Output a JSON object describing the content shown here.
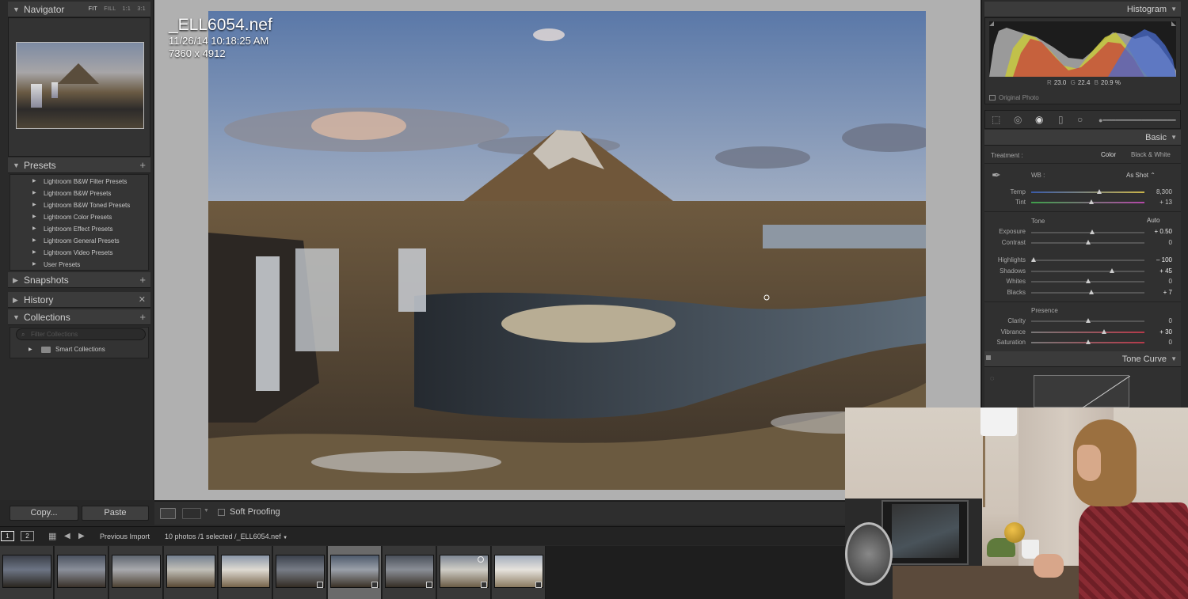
{
  "left_panel": {
    "navigator": {
      "title": "Navigator",
      "zoom": [
        "FIT",
        "FILL",
        "1:1",
        "3:1"
      ]
    },
    "presets": {
      "title": "Presets",
      "items": [
        "Lightroom B&W Filter Presets",
        "Lightroom B&W Presets",
        "Lightroom B&W Toned Presets",
        "Lightroom Color Presets",
        "Lightroom Effect Presets",
        "Lightroom General Presets",
        "Lightroom Video Presets",
        "User Presets"
      ]
    },
    "snapshots": {
      "title": "Snapshots"
    },
    "history": {
      "title": "History"
    },
    "collections": {
      "title": "Collections",
      "search_placeholder": "Filter Collections",
      "items": [
        "Smart Collections"
      ]
    },
    "copy_label": "Copy...",
    "paste_label": "Paste"
  },
  "photo_info": {
    "filename": "_ELL6054.nef",
    "datetime": "11/26/14 10:18:25 AM",
    "dimensions": "7360 x 4912"
  },
  "toolbar": {
    "soft_proofing": "Soft Proofing"
  },
  "filmstrip": {
    "screen1": "1",
    "screen2": "2",
    "source": "Previous Import",
    "status": "10 photos /1 selected /_ELL6054.nef",
    "thumb_count": 10,
    "selected_index": 6
  },
  "right_panel": {
    "histogram": {
      "title": "Histogram",
      "r_key": "R",
      "r": "23.0",
      "g_key": "G",
      "g": "22.4",
      "b_key": "B",
      "b": "20.9",
      "pct": "%",
      "original_photo": "Original Photo"
    },
    "basic": {
      "title": "Basic",
      "treatment_label": "Treatment :",
      "color_label": "Color",
      "bw_label": "Black & White",
      "wb_label": "WB :",
      "wb_value": "As Shot",
      "tone_label": "Tone",
      "auto_label": "Auto",
      "presence_label": "Presence",
      "sliders": [
        {
          "key": "temp",
          "label": "Temp",
          "value": "8,300",
          "pos": 0.6
        },
        {
          "key": "tint",
          "label": "Tint",
          "value": "+ 13",
          "pos": 0.53
        },
        {
          "key": "exposure",
          "label": "Exposure",
          "value": "+ 0.50",
          "pos": 0.54
        },
        {
          "key": "contrast",
          "label": "Contrast",
          "value": "0",
          "pos": 0.5
        },
        {
          "key": "highlights",
          "label": "Highlights",
          "value": "– 100",
          "pos": 0.02
        },
        {
          "key": "shadows",
          "label": "Shadows",
          "value": "+ 45",
          "pos": 0.71
        },
        {
          "key": "whites",
          "label": "Whites",
          "value": "0",
          "pos": 0.5
        },
        {
          "key": "blacks",
          "label": "Blacks",
          "value": "+ 7",
          "pos": 0.53
        },
        {
          "key": "clarity",
          "label": "Clarity",
          "value": "0",
          "pos": 0.5
        },
        {
          "key": "vibrance",
          "label": "Vibrance",
          "value": "+ 30",
          "pos": 0.64
        },
        {
          "key": "saturation",
          "label": "Saturation",
          "value": "0",
          "pos": 0.5
        }
      ]
    },
    "tone_curve": {
      "title": "Tone Curve"
    }
  },
  "colors": {
    "accent": "#b0b0b0",
    "panel": "#2a2a2a"
  }
}
